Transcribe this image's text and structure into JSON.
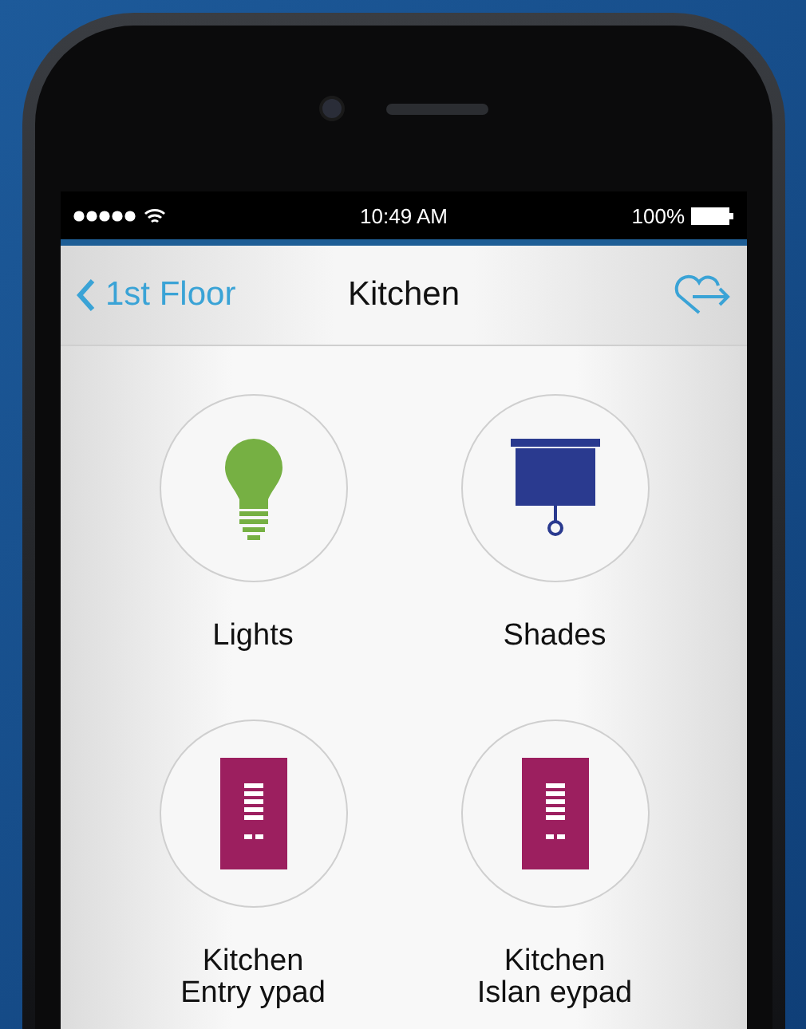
{
  "status_bar": {
    "time": "10:49 AM",
    "battery": "100%"
  },
  "nav": {
    "back": "1st Floor",
    "title": "Kitchen"
  },
  "tiles": [
    {
      "kind": "bulb",
      "lines": [
        "Lights"
      ]
    },
    {
      "kind": "screen",
      "lines": [
        "Shades"
      ]
    },
    {
      "kind": "keypad",
      "lines": [
        "Kitchen",
        "Entry ypad"
      ]
    },
    {
      "kind": "keypad",
      "lines": [
        "Kitchen",
        "Islan eypad"
      ]
    }
  ]
}
